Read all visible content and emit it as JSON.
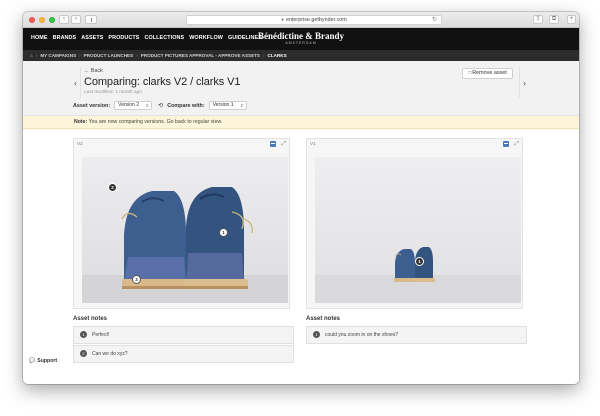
{
  "browser": {
    "url": "enterprise.getbynder.com",
    "lock_icon": "lock-icon",
    "back_glyph": "‹",
    "forward_glyph": "›",
    "reload_glyph": "↻",
    "share_glyph": "⇪",
    "tabs_glyph": "⧉",
    "newtab_glyph": "+"
  },
  "nav": {
    "items": [
      "HOME",
      "BRANDS",
      "ASSETS",
      "PRODUCTS",
      "COLLECTIONS",
      "WORKFLOW",
      "GUIDELINES"
    ]
  },
  "brand": {
    "name": "Bénédictine & Brandy",
    "subtitle": "AMSTERDAM"
  },
  "breadcrumb": {
    "home_icon": "⌂",
    "separator": "›",
    "items": [
      "MY CAMPAIGNS",
      "PRODUCT LAUNCHES",
      "PRODUCT PICTURES APPROVAL - APPROVE ASSETS",
      "CLARKS"
    ]
  },
  "header": {
    "back_label": "← Back",
    "title": "Comparing: clarks V2 / clarks V1",
    "last_modified": "Last modified: 1 month ago",
    "remove_label": "Remove asset",
    "prev_arrow": "‹",
    "next_arrow": "›",
    "asset_version_label": "Asset version:",
    "asset_version_value": "Version 2",
    "compare_label": "Compare with:",
    "compare_value": "Version 1",
    "compare_icon": "⟲",
    "caret": "⇕"
  },
  "notice": {
    "bold": "Note:",
    "text": "You are now comparing versions. Go back to regular view."
  },
  "panels": {
    "left": {
      "label": "V2"
    },
    "right": {
      "label": "V1"
    },
    "expand_glyph": "⤢"
  },
  "markers": {
    "left": [
      "2",
      "1",
      "3"
    ],
    "right": [
      "1"
    ]
  },
  "notes": {
    "title": "Asset notes",
    "left": [
      {
        "num": "1",
        "text": "Perfect!"
      },
      {
        "num": "2",
        "text": "Can we do xyz?"
      }
    ],
    "right": [
      {
        "num": "1",
        "text": "could you zoom in on the shoes?"
      }
    ]
  },
  "support": {
    "label": "Support",
    "icon": "💬"
  }
}
